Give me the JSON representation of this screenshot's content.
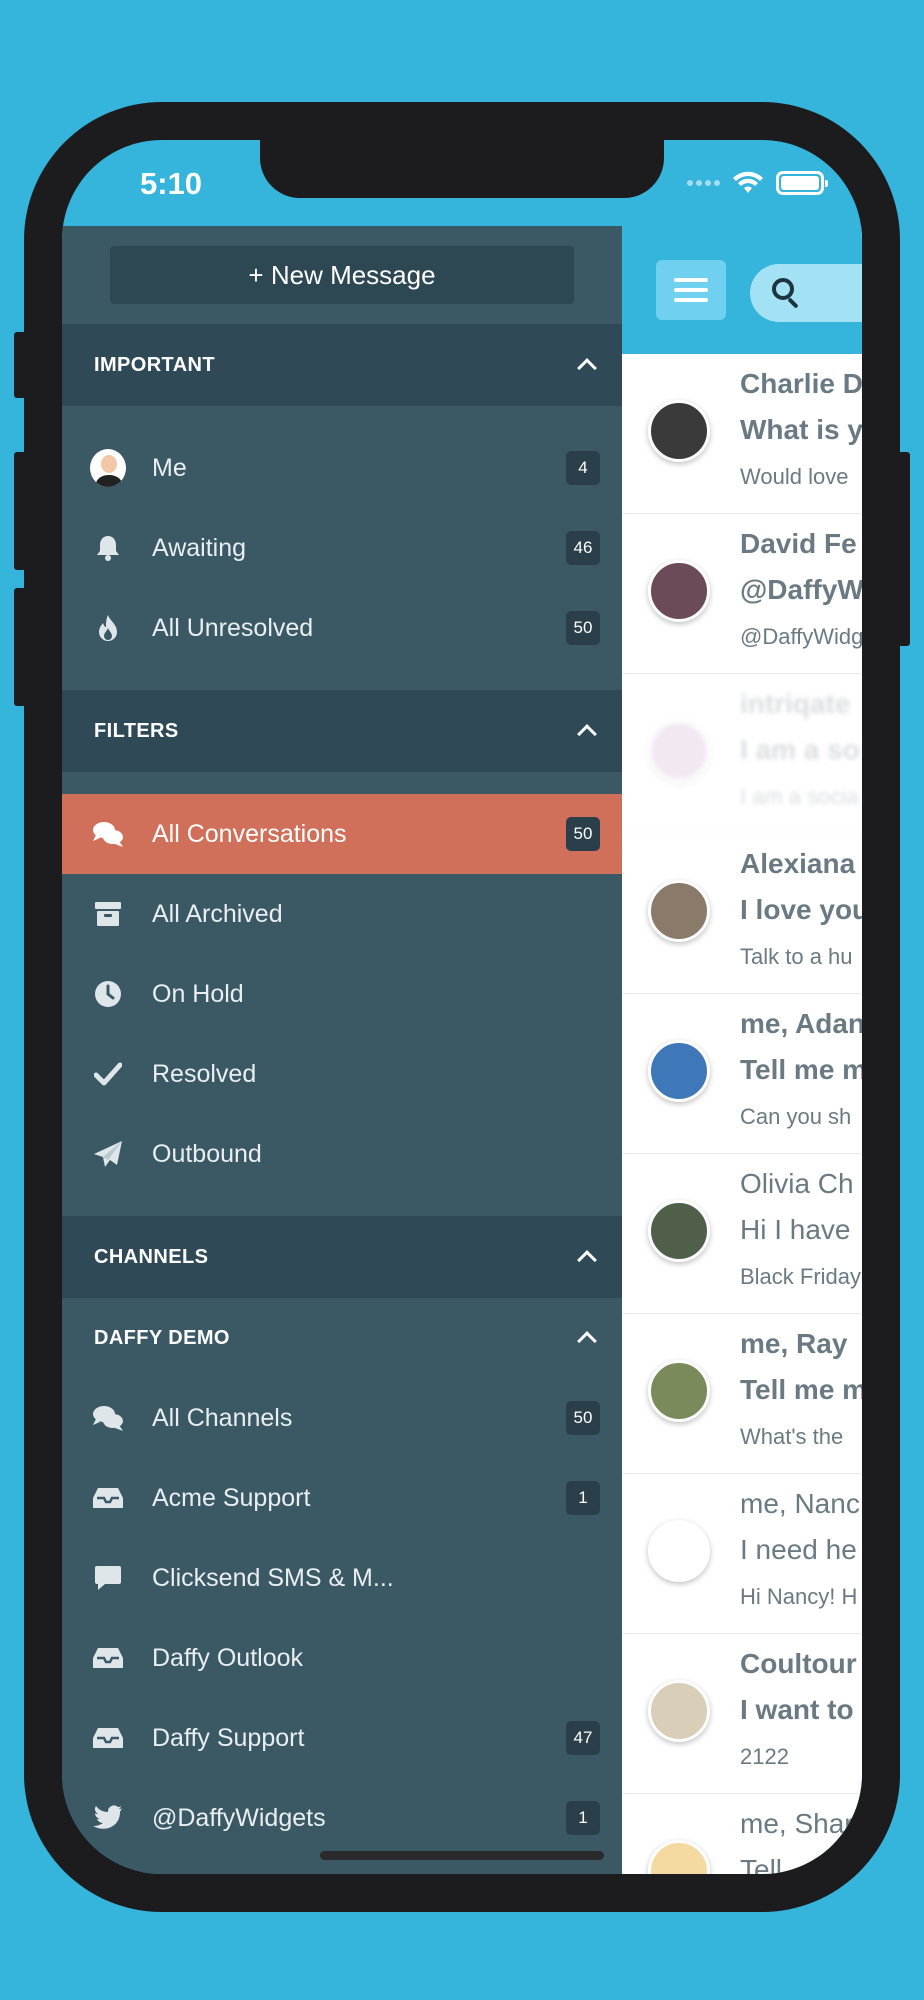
{
  "status": {
    "time": "5:10"
  },
  "sidebar": {
    "new_message": "+ New Message",
    "important": {
      "title": "IMPORTANT",
      "items": [
        {
          "icon": "avatar",
          "label": "Me",
          "count": "4"
        },
        {
          "icon": "bell-icon",
          "label": "Awaiting",
          "count": "46"
        },
        {
          "icon": "fire-icon",
          "label": "All Unresolved",
          "count": "50"
        }
      ]
    },
    "filters": {
      "title": "FILTERS",
      "items": [
        {
          "icon": "chat-bubbles-icon",
          "label": "All Conversations",
          "count": "50",
          "active": true
        },
        {
          "icon": "archive-icon",
          "label": "All Archived",
          "count": ""
        },
        {
          "icon": "clock-icon",
          "label": "On Hold",
          "count": ""
        },
        {
          "icon": "checkmark-icon",
          "label": "Resolved",
          "count": ""
        },
        {
          "icon": "paper-plane-icon",
          "label": "Outbound",
          "count": ""
        }
      ]
    },
    "channels": {
      "title": "CHANNELS",
      "group": "DAFFY DEMO",
      "items": [
        {
          "icon": "chat-bubbles-icon",
          "label": "All Channels",
          "count": "50"
        },
        {
          "icon": "inbox-icon",
          "label": "Acme Support",
          "count": "1"
        },
        {
          "icon": "speech-bubble-icon",
          "label": "Clicksend SMS & M...",
          "count": ""
        },
        {
          "icon": "inbox-icon",
          "label": "Daffy Outlook",
          "count": ""
        },
        {
          "icon": "inbox-icon",
          "label": "Daffy Support",
          "count": "47"
        },
        {
          "icon": "twitter-icon",
          "label": "@DaffyWidgets",
          "count": "1"
        }
      ]
    }
  },
  "conversations": [
    {
      "name": "Charlie D",
      "subject": "What is y",
      "preview": "Would love",
      "unread": true
    },
    {
      "name": "David Fe",
      "subject": "@DaffyW",
      "preview": "@DaffyWidg",
      "unread": true
    },
    {
      "name": "intriqate",
      "subject": "I am a so",
      "preview": "I am a socia",
      "unread": true
    },
    {
      "name": "Alexiana",
      "subject": "I love you",
      "preview": "Talk to a hu",
      "unread": true
    },
    {
      "name": "me, Adan",
      "subject": "Tell me m",
      "preview": "Can you sh",
      "unread": true
    },
    {
      "name": "Olivia Ch",
      "subject": "Hi I have",
      "preview": "Black Friday",
      "unread": false
    },
    {
      "name": "me, Ray",
      "subject": "Tell me m",
      "preview": "What's the",
      "unread": true
    },
    {
      "name": "me, Nanc",
      "subject": "I need he",
      "preview": "Hi Nancy! H",
      "unread": false
    },
    {
      "name": "Coultour",
      "subject": "I want to",
      "preview": "2122",
      "unread": true
    },
    {
      "name": "me, Shar",
      "subject": "Tell",
      "preview": "",
      "unread": false
    }
  ],
  "colors": {
    "background": "#35b4dc",
    "sidebar": "#3b5865",
    "active": "#d0705a"
  }
}
